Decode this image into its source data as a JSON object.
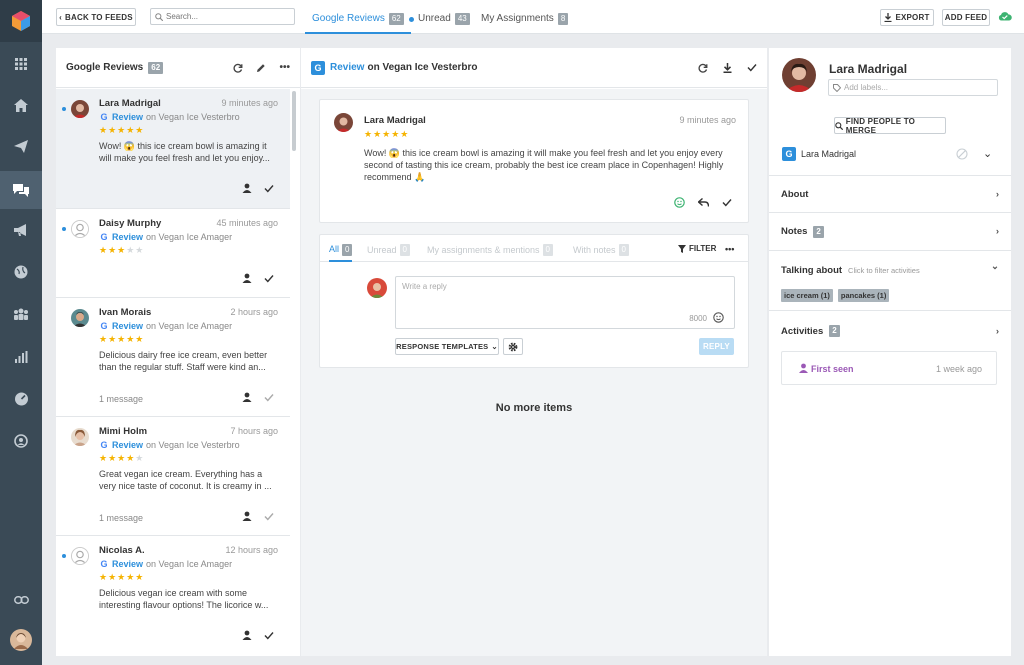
{
  "toolbar": {
    "back_label": "BACK TO FEEDS",
    "search_placeholder": "Search...",
    "tabs": [
      {
        "label": "Google Reviews",
        "count": "62"
      },
      {
        "label": "Unread",
        "count": "43"
      },
      {
        "label": "My Assignments",
        "count": "8"
      }
    ],
    "export_label": "EXPORT",
    "add_feed_label": "ADD FEED"
  },
  "feed": {
    "title": "Google Reviews",
    "count": "62",
    "items": [
      {
        "name": "Lara Madrigal",
        "time": "9 minutes ago",
        "type": "Review",
        "location": "on Vegan Ice Vesterbro",
        "rating": 5,
        "text": "Wow! 😱 this ice cream bowl is amazing it will make you feel fresh and let you enjoy...",
        "message": ""
      },
      {
        "name": "Daisy Murphy",
        "time": "45 minutes ago",
        "type": "Review",
        "location": "on Vegan Ice Amager",
        "rating": 3,
        "text": "",
        "message": ""
      },
      {
        "name": "Ivan Morais",
        "time": "2 hours ago",
        "type": "Review",
        "location": "on Vegan Ice Amager",
        "rating": 5,
        "text": "Delicious dairy free ice cream, even better than the regular stuff. Staff were kind an...",
        "message": "1 message"
      },
      {
        "name": "Mimi Holm",
        "time": "7 hours ago",
        "type": "Review",
        "location": "on Vegan Ice Vesterbro",
        "rating": 4,
        "text": "Great vegan ice cream. Everything has a very nice taste of coconut. It is creamy in ...",
        "message": "1 message"
      },
      {
        "name": "Nicolas A.",
        "time": "12 hours ago",
        "type": "Review",
        "location": "on Vegan Ice Amager",
        "rating": 5,
        "text": "Delicious vegan ice cream with some interesting flavour options! The licorice w...",
        "message": ""
      }
    ]
  },
  "detail": {
    "header_type": "Review",
    "header_location": "on Vegan Ice Vesterbro",
    "review": {
      "name": "Lara Madrigal",
      "time": "9 minutes ago",
      "rating": 5,
      "text": "Wow! 😱 this ice cream bowl is amazing it will make you feel fresh and let you enjoy every second of tasting this ice cream, probably the best ice cream place in Copenhagen! Highly recommend 🙏"
    },
    "subtabs": [
      {
        "label": "All",
        "count": "0"
      },
      {
        "label": "Unread",
        "count": "0"
      },
      {
        "label": "My assignments & mentions",
        "count": "0"
      },
      {
        "label": "With notes",
        "count": "0"
      }
    ],
    "filter_label": "FILTER",
    "reply_placeholder": "Write a reply",
    "char_count": "8000",
    "templates_label": "RESPONSE TEMPLATES",
    "reply_label": "REPLY",
    "empty_label": "No more items"
  },
  "profile": {
    "name": "Lara Madrigal",
    "labels_placeholder": "Add labels...",
    "merge_label": "FIND PEOPLE TO MERGE",
    "source_name": "Lara Madrigal",
    "about_label": "About",
    "notes_label": "Notes",
    "notes_count": "2",
    "talking_label": "Talking about",
    "talking_hint": "Click to filter activities",
    "tags": [
      "ice cream (1)",
      "pancakes (1)"
    ],
    "activities_label": "Activities",
    "activities_count": "2",
    "first_seen_label": "First seen",
    "first_seen_time": "1 week ago"
  },
  "colors": {
    "accent": "#2d8fdb",
    "rail": "#3a4a56",
    "star": "#f5b301",
    "first_seen": "#9b59b6"
  }
}
